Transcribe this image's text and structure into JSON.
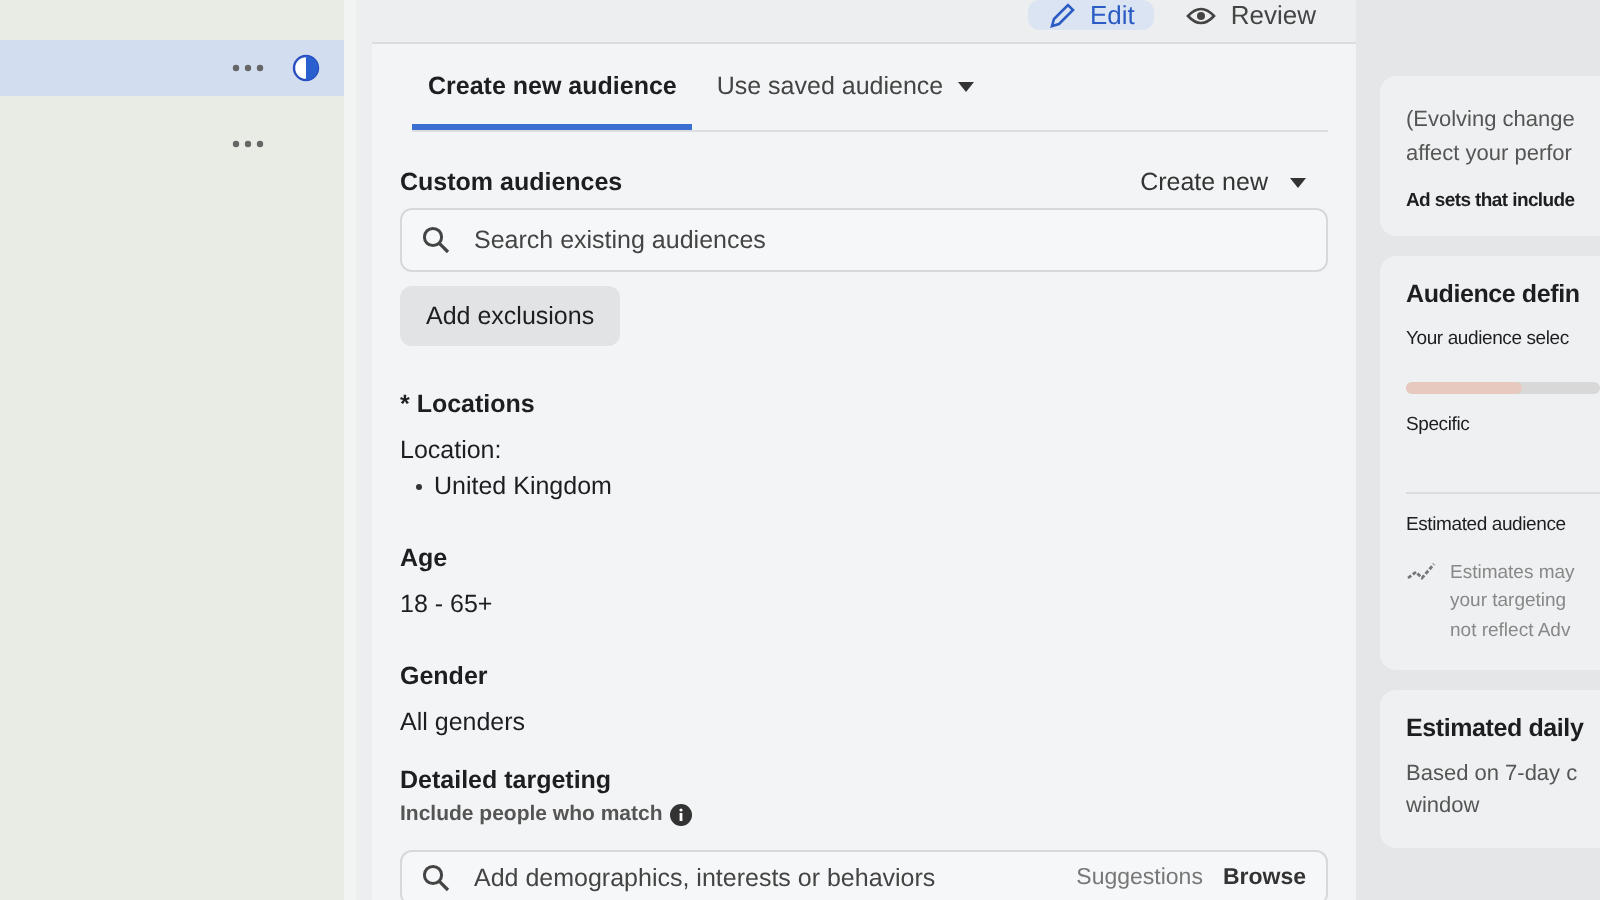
{
  "sidebar": {
    "items": [
      {
        "selected": true,
        "status_icon": true
      },
      {
        "selected": false,
        "status_icon": false
      }
    ]
  },
  "mode_switch": [
    {
      "label": "Edit",
      "kind": "edit",
      "selected": true
    },
    {
      "label": "Review",
      "kind": "review",
      "selected": false
    }
  ],
  "tabs": [
    {
      "label": "Create new audience",
      "selected": true,
      "dropdown": false
    },
    {
      "label": "Use saved audience",
      "selected": false,
      "dropdown": true
    }
  ],
  "custom_audiences": {
    "title": "Custom audiences",
    "action": "Create new",
    "search": {
      "placeholder": "Search existing audiences"
    },
    "button": "Add exclusions"
  },
  "locations": {
    "title": "* Locations",
    "label": "Location:",
    "items": [
      "United Kingdom"
    ]
  },
  "age": {
    "title": "Age",
    "value": "18 - 65+"
  },
  "gender": {
    "title": "Gender",
    "value": "All genders"
  },
  "detailed_targeting": {
    "title": "Detailed targeting",
    "subtitle": "Include people who match",
    "search": {
      "placeholder": "Add demographics, interests or behaviors"
    },
    "links": [
      "Suggestions",
      "Browse"
    ]
  },
  "right_panel": {
    "note": [
      "(Evolving change",
      "affect your perfor"
    ],
    "note_bold": "Ad sets that include",
    "definition": {
      "title": "Audience defin",
      "subtitle": "Your audience selec",
      "level": 0.6,
      "level_label": "Specific",
      "estimate_title": "Estimated audience",
      "estimate_note": [
        "Estimates may",
        "your targeting",
        "not reflect Adv"
      ]
    },
    "daily": {
      "title": "Estimated daily",
      "text": [
        "Based on 7-day c",
        "window"
      ]
    }
  }
}
